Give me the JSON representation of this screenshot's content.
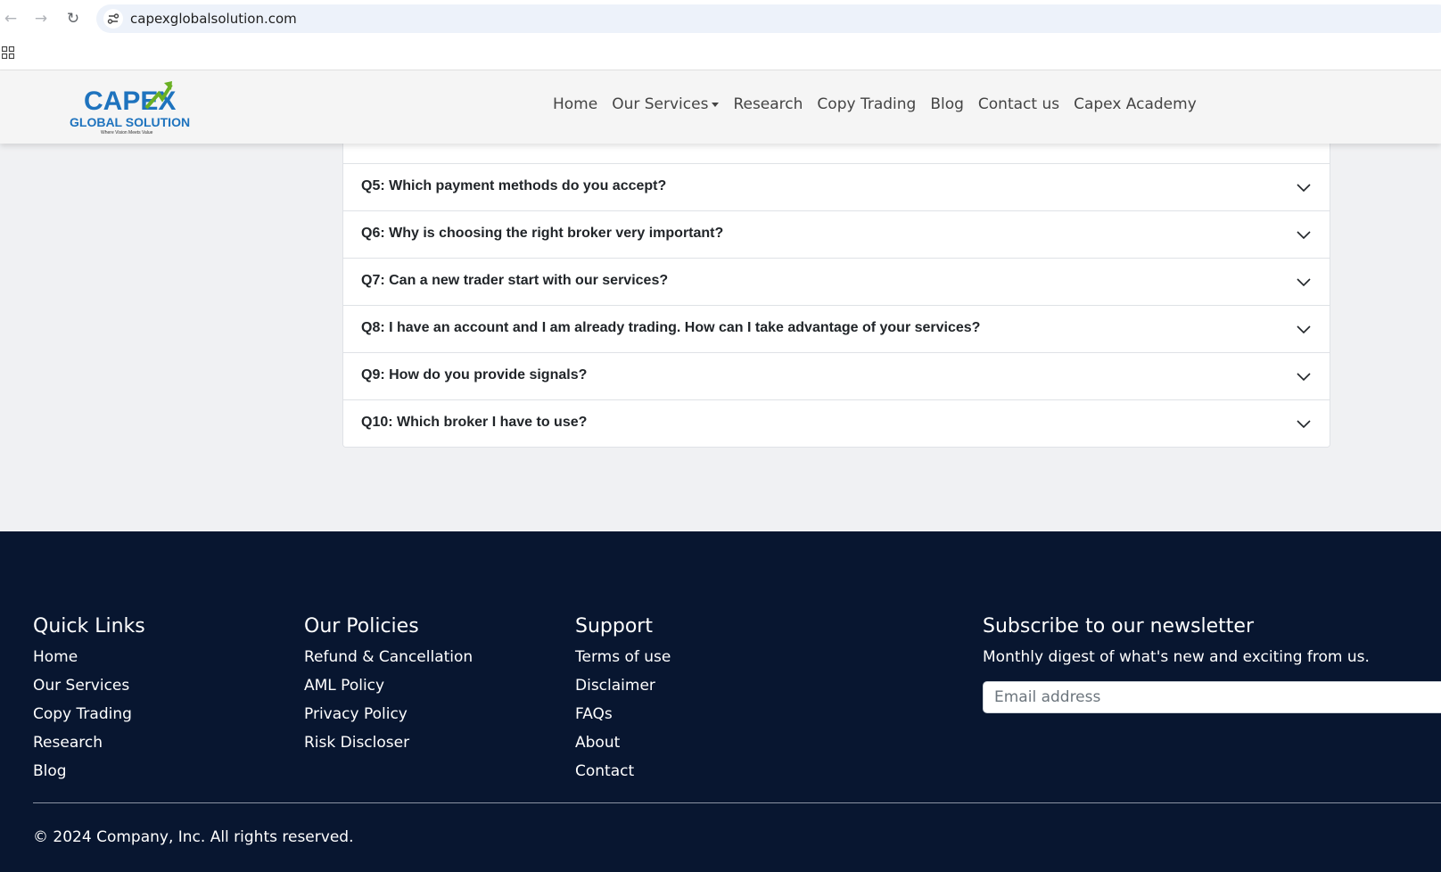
{
  "browser": {
    "url": "capexglobalsolution.com",
    "back_glyph": "←",
    "forward_glyph": "→",
    "reload_glyph": "↻",
    "icons": [
      "back-icon",
      "forward-icon",
      "reload-icon",
      "site-info-icon",
      "apps-icon"
    ]
  },
  "header": {
    "logo_main": "CAPEX",
    "logo_sub": "GLOBAL SOLUTION",
    "logo_tagline": "Where Vision Meets Value",
    "brand_color": "#1e73be",
    "accent_color": "#6ab023",
    "nav": [
      {
        "label": "Home"
      },
      {
        "label": "Our Services",
        "dropdown": true
      },
      {
        "label": "Research"
      },
      {
        "label": "Copy Trading"
      },
      {
        "label": "Blog"
      },
      {
        "label": "Contact us"
      },
      {
        "label": "Capex Academy"
      }
    ]
  },
  "faq": {
    "items": [
      {
        "question": "Q5: Which payment methods do you accept?"
      },
      {
        "question": "Q6: Why is choosing the right broker very important?"
      },
      {
        "question": "Q7: Can a new trader start with our services?"
      },
      {
        "question": "Q8: I have an account and I am already trading. How can I take advantage of your services?"
      },
      {
        "question": "Q9: How do you provide signals?"
      },
      {
        "question": "Q10: Which broker I have to use?"
      }
    ]
  },
  "footer": {
    "background": "#081630",
    "quick_links": {
      "heading": "Quick Links",
      "links": [
        "Home",
        "Our Services",
        "Copy Trading",
        "Research",
        "Blog"
      ]
    },
    "policies": {
      "heading": "Our Policies",
      "links": [
        "Refund & Cancellation",
        "AML Policy",
        "Privacy Policy",
        "Risk Discloser"
      ]
    },
    "support": {
      "heading": "Support",
      "links": [
        "Terms of use",
        "Disclaimer",
        "FAQs",
        "About",
        "Contact"
      ]
    },
    "newsletter": {
      "heading": "Subscribe to our newsletter",
      "description": "Monthly digest of what's new and exciting from us.",
      "email_placeholder": "Email address",
      "email_value": ""
    },
    "copyright": "© 2024 Company, Inc. All rights reserved."
  }
}
